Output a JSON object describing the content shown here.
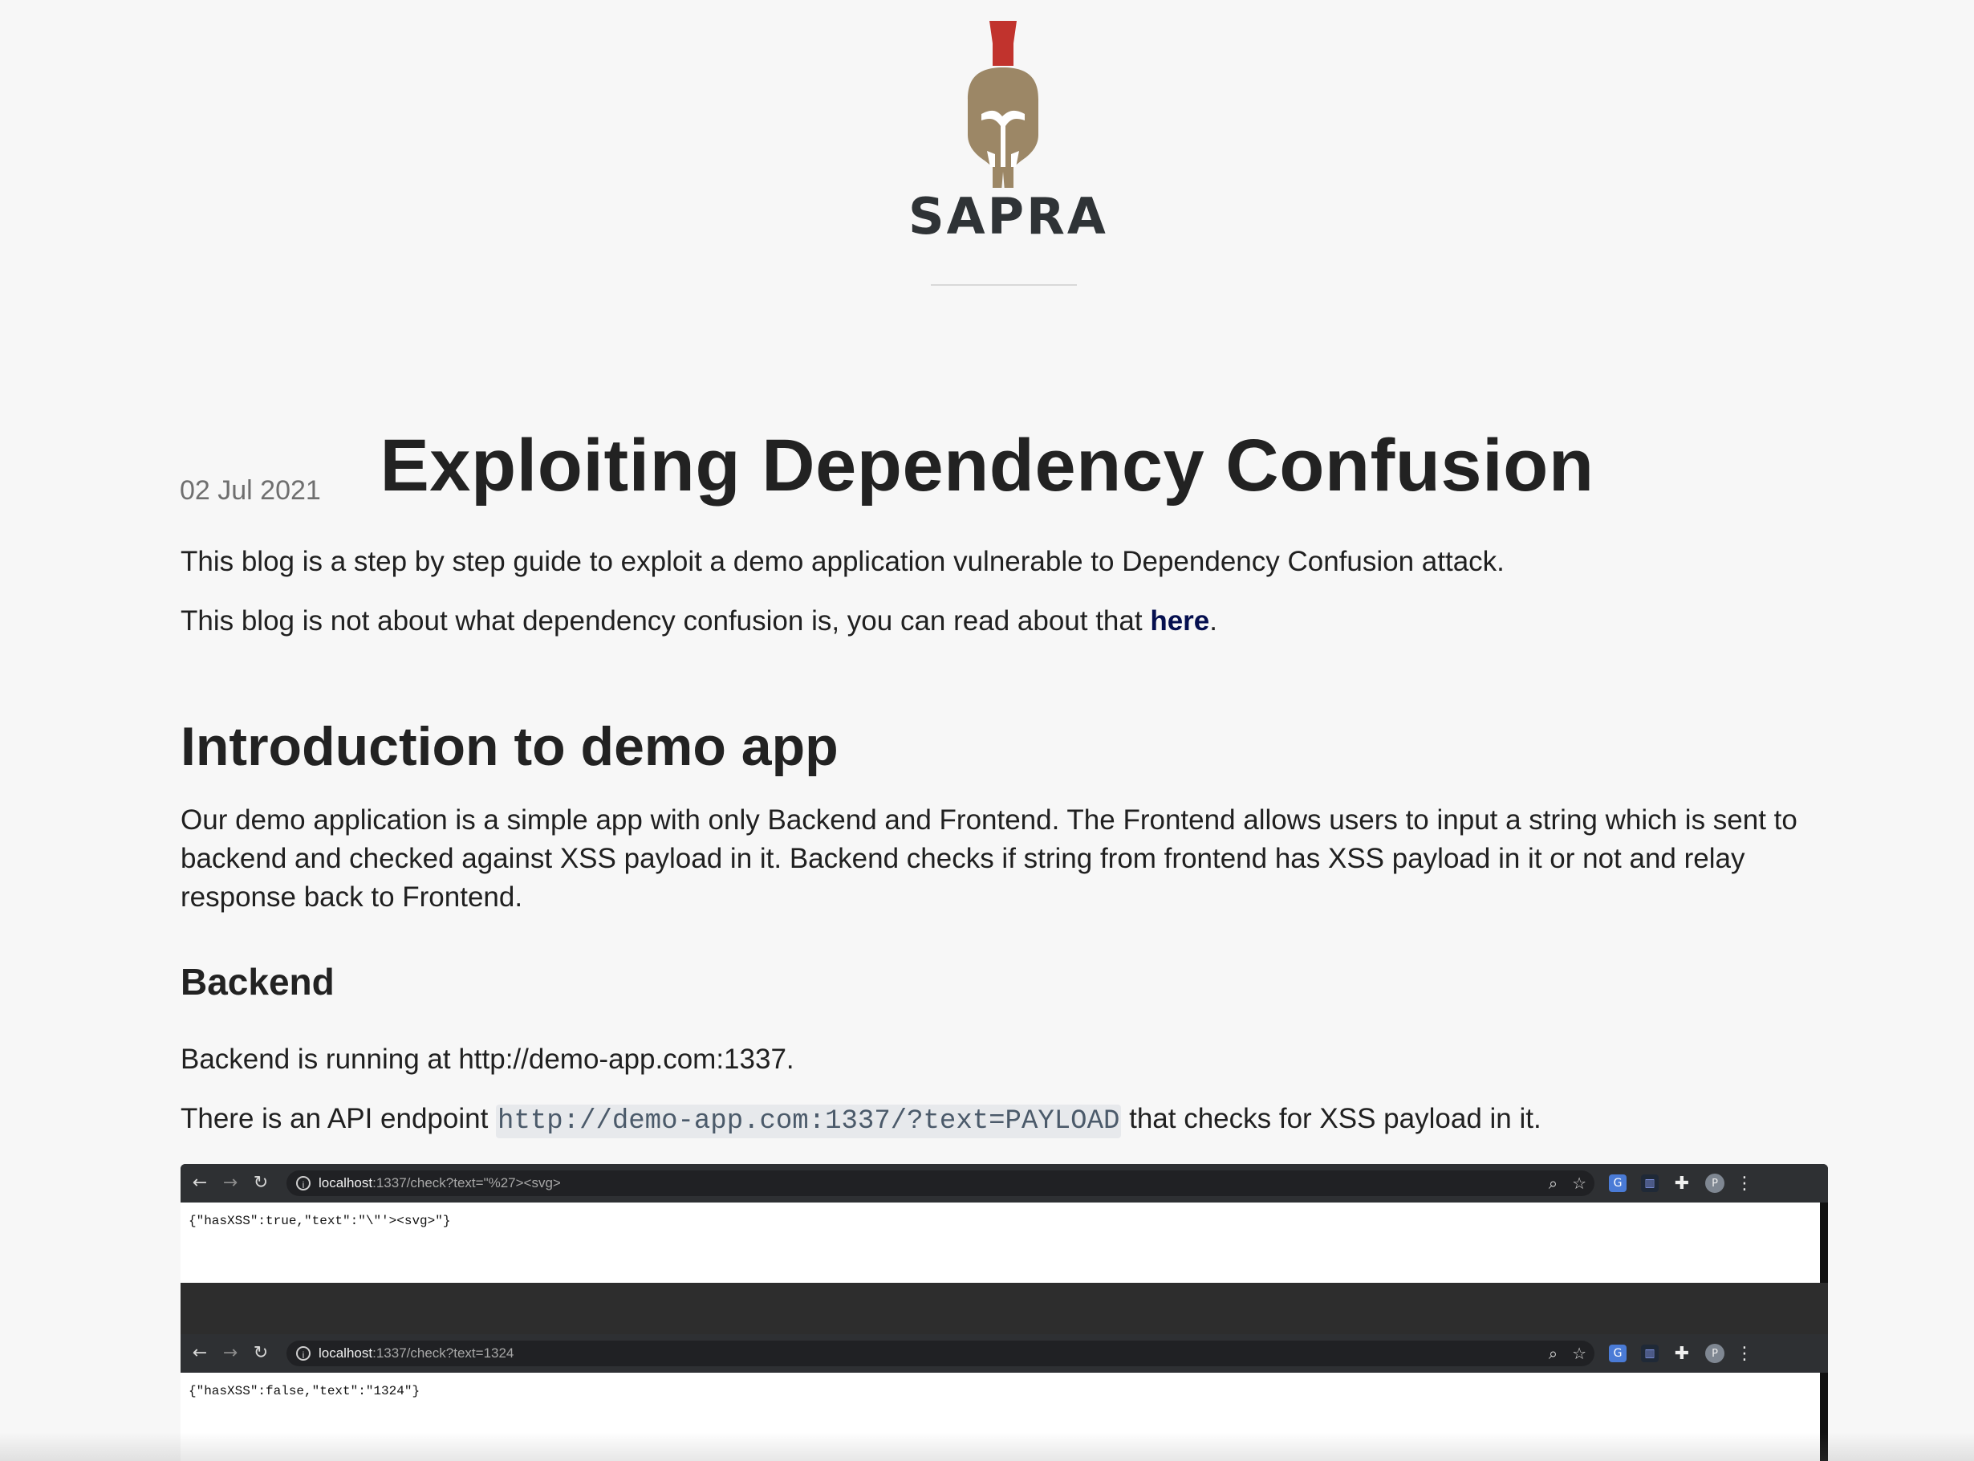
{
  "header": {
    "brand_text": "SAPRA",
    "colors": {
      "plume": "#c1332d",
      "helmet": "#9c8766",
      "brand_text": "#2f3336"
    }
  },
  "article": {
    "title": "Exploiting Dependency Confusion",
    "date": "02 Jul 2021",
    "intro_1": "This blog is a step by step guide to exploit a demo application vulnerable to Dependency Confusion attack.",
    "intro_2_prefix": "This blog is not about what dependency confusion is, you can read about that ",
    "intro_2_link": "here",
    "intro_2_suffix": ".",
    "section_heading": "Introduction to demo app",
    "section_body": "Our demo application is a simple app with only Backend and Frontend. The Frontend allows users to input a string which is sent to backend and checked against XSS payload in it. Backend checks if string from frontend has XSS payload in it or not and relay response back to Frontend.",
    "subsection_heading": "Backend",
    "backend_text": "Backend is running at http://demo-app.com:1337.",
    "endpoint_prefix": "There is an API endpoint ",
    "endpoint_code": "http://demo-app.com:1337/?text=PAYLOAD",
    "endpoint_suffix": " that checks for XSS payload in it."
  },
  "screenshot": {
    "top": {
      "url_host": "localhost",
      "url_rest": ":1337/check?text=\"%27><svg>",
      "response": "{\"hasXSS\":true,\"text\":\"\\\"'><svg>\"}"
    },
    "second": {
      "url_host": "localhost",
      "url_rest": ":1337/check?text=1324",
      "response": "{\"hasXSS\":false,\"text\":\"1324\"}"
    },
    "icons": {
      "back": "arrow-left-icon",
      "forward": "arrow-right-icon",
      "reload": "reload-icon",
      "info": "info-icon",
      "zoom": "zoom-icon",
      "star": "star-icon",
      "google": "google-translate-icon",
      "chart": "chart-extension-icon",
      "puzzle": "puzzle-icon",
      "profile": "profile-icon",
      "menu": "kebab-menu-icon"
    },
    "avatar_letter": "P"
  }
}
